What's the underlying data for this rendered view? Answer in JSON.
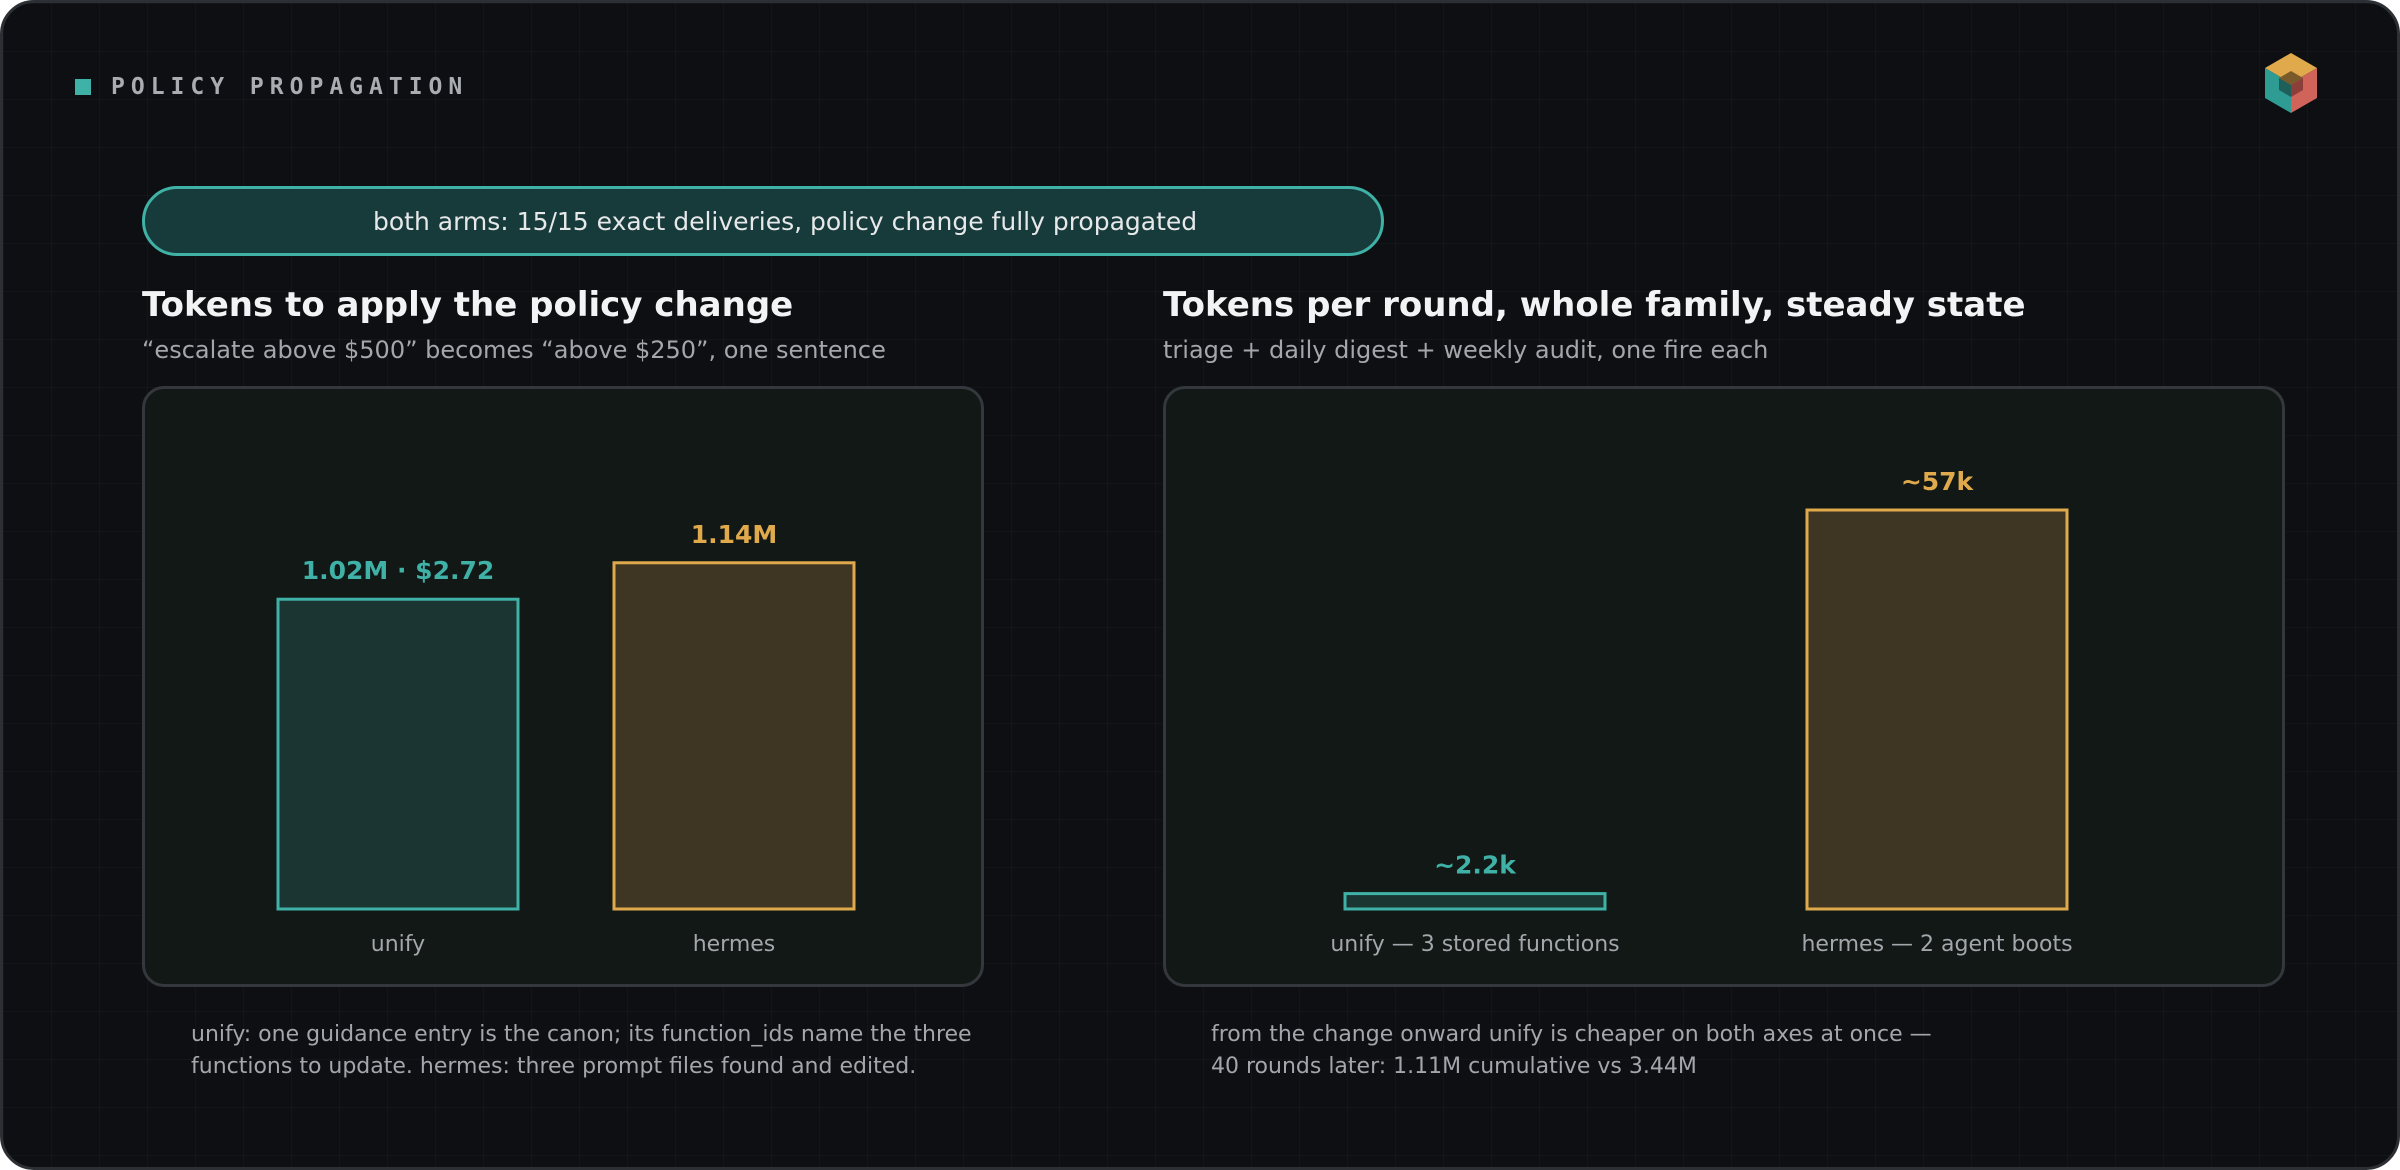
{
  "section": {
    "title": "POLICY PROPAGATION",
    "icon": "square-bullet-icon"
  },
  "logo": {
    "icon": "cube-logo-icon"
  },
  "banner": {
    "text": "both arms: 15/15 exact deliveries, policy change fully propagated"
  },
  "colors": {
    "unify": "#3fb1a6",
    "unify_fill": "#1b3632",
    "hermes": "#e0aa4c",
    "hermes_fill": "#3e3522",
    "axis_label": "#a3a6aa"
  },
  "chart_data": [
    {
      "type": "bar",
      "title": "Tokens to apply the policy change",
      "subtitle": "“escalate above $500” becomes “above $250”, one sentence",
      "categories": [
        "unify",
        "hermes"
      ],
      "values": [
        1020000,
        1140000
      ],
      "data_labels": [
        "1.02M · $2.72",
        "1.14M"
      ],
      "ylim": [
        0,
        1350000
      ],
      "grid": false,
      "legend": "none"
    },
    {
      "type": "bar",
      "title": "Tokens per round, whole family, steady state",
      "subtitle": "triage + daily digest + weekly audit, one fire each",
      "categories": [
        "unify — 3 stored functions",
        "hermes — 2 agent boots"
      ],
      "values": [
        2200,
        57000
      ],
      "data_labels": [
        "~2.2k",
        "~57k"
      ],
      "ylim": [
        0,
        65000
      ],
      "grid": false,
      "legend": "none"
    }
  ],
  "captions": {
    "left": [
      "unify: one guidance entry is the canon; its function_ids name the three",
      "functions to update. hermes: three prompt files found and edited."
    ],
    "right": [
      "from the change onward unify is cheaper on both axes at once —",
      "40 rounds later: 1.11M cumulative vs 3.44M"
    ]
  }
}
